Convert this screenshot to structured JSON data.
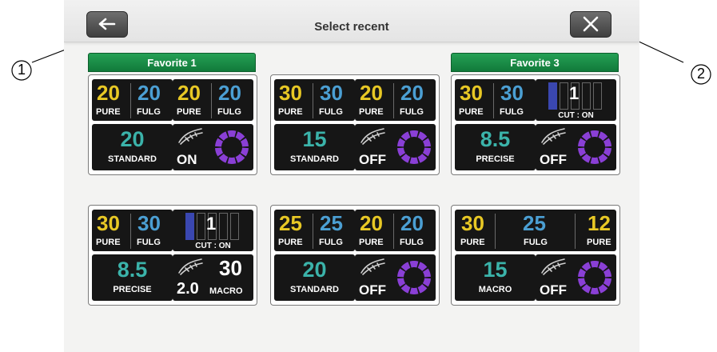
{
  "header": {
    "title": "Select recent"
  },
  "callouts": [
    "1",
    "2"
  ],
  "cards": [
    {
      "favorite": "Favorite 1",
      "tiles": [
        {
          "type": "pair",
          "a_val": "20",
          "a_lbl": "PURE",
          "b_val": "20",
          "b_lbl": "FULG"
        },
        {
          "type": "pair",
          "a_val": "20",
          "a_lbl": "PURE",
          "b_val": "20",
          "b_lbl": "FULG"
        },
        {
          "type": "mode",
          "val": "20",
          "lbl": "STANDARD"
        },
        {
          "type": "handpiece",
          "state": "ON"
        }
      ]
    },
    {
      "favorite": "",
      "tiles": [
        {
          "type": "pair",
          "a_val": "30",
          "a_lbl": "PURE",
          "b_val": "30",
          "b_lbl": "FULG"
        },
        {
          "type": "pair",
          "a_val": "20",
          "a_lbl": "PURE",
          "b_val": "20",
          "b_lbl": "FULG"
        },
        {
          "type": "mode",
          "val": "15",
          "lbl": "STANDARD"
        },
        {
          "type": "handpiece",
          "state": "OFF"
        }
      ]
    },
    {
      "favorite": "Favorite 3",
      "tiles": [
        {
          "type": "pair",
          "a_val": "30",
          "a_lbl": "PURE",
          "b_val": "30",
          "b_lbl": "FULG"
        },
        {
          "type": "cut",
          "level": "1",
          "lbl": "CUT : ON"
        },
        {
          "type": "mode",
          "val": "8.5",
          "lbl": "PRECISE"
        },
        {
          "type": "handpiece",
          "state": "OFF"
        }
      ]
    },
    {
      "favorite": "",
      "tiles": [
        {
          "type": "pair",
          "a_val": "30",
          "a_lbl": "PURE",
          "b_val": "30",
          "b_lbl": "FULG"
        },
        {
          "type": "cut",
          "level": "1",
          "lbl": "CUT : ON"
        },
        {
          "type": "mode",
          "val": "8.5",
          "lbl": "PRECISE"
        },
        {
          "type": "macro",
          "val": "30",
          "sub": "2.0",
          "lbl": "MACRO"
        }
      ]
    },
    {
      "favorite": "",
      "tiles": [
        {
          "type": "pair",
          "a_val": "25",
          "a_lbl": "PURE",
          "b_val": "25",
          "b_lbl": "FULG"
        },
        {
          "type": "pair",
          "a_val": "20",
          "a_lbl": "PURE",
          "b_val": "20",
          "b_lbl": "FULG"
        },
        {
          "type": "mode",
          "val": "20",
          "lbl": "STANDARD"
        },
        {
          "type": "handpiece",
          "state": "OFF"
        }
      ]
    },
    {
      "favorite": "",
      "tiles": [
        {
          "type": "triple",
          "a_val": "30",
          "a_lbl": "PURE",
          "b_val": "25",
          "b_lbl": "FULG",
          "c_val": "12",
          "c_lbl": "PURE"
        },
        {
          "type": "mode",
          "val": "15",
          "lbl": "MACRO"
        },
        {
          "type": "handpiece",
          "state": "OFF"
        }
      ]
    }
  ],
  "colors": {
    "pure": "#e8c825",
    "fulg": "#4b9fd3",
    "mode": "#3bb3aa",
    "favorite": "#1a8c46",
    "ring": "#8a3fd6"
  }
}
